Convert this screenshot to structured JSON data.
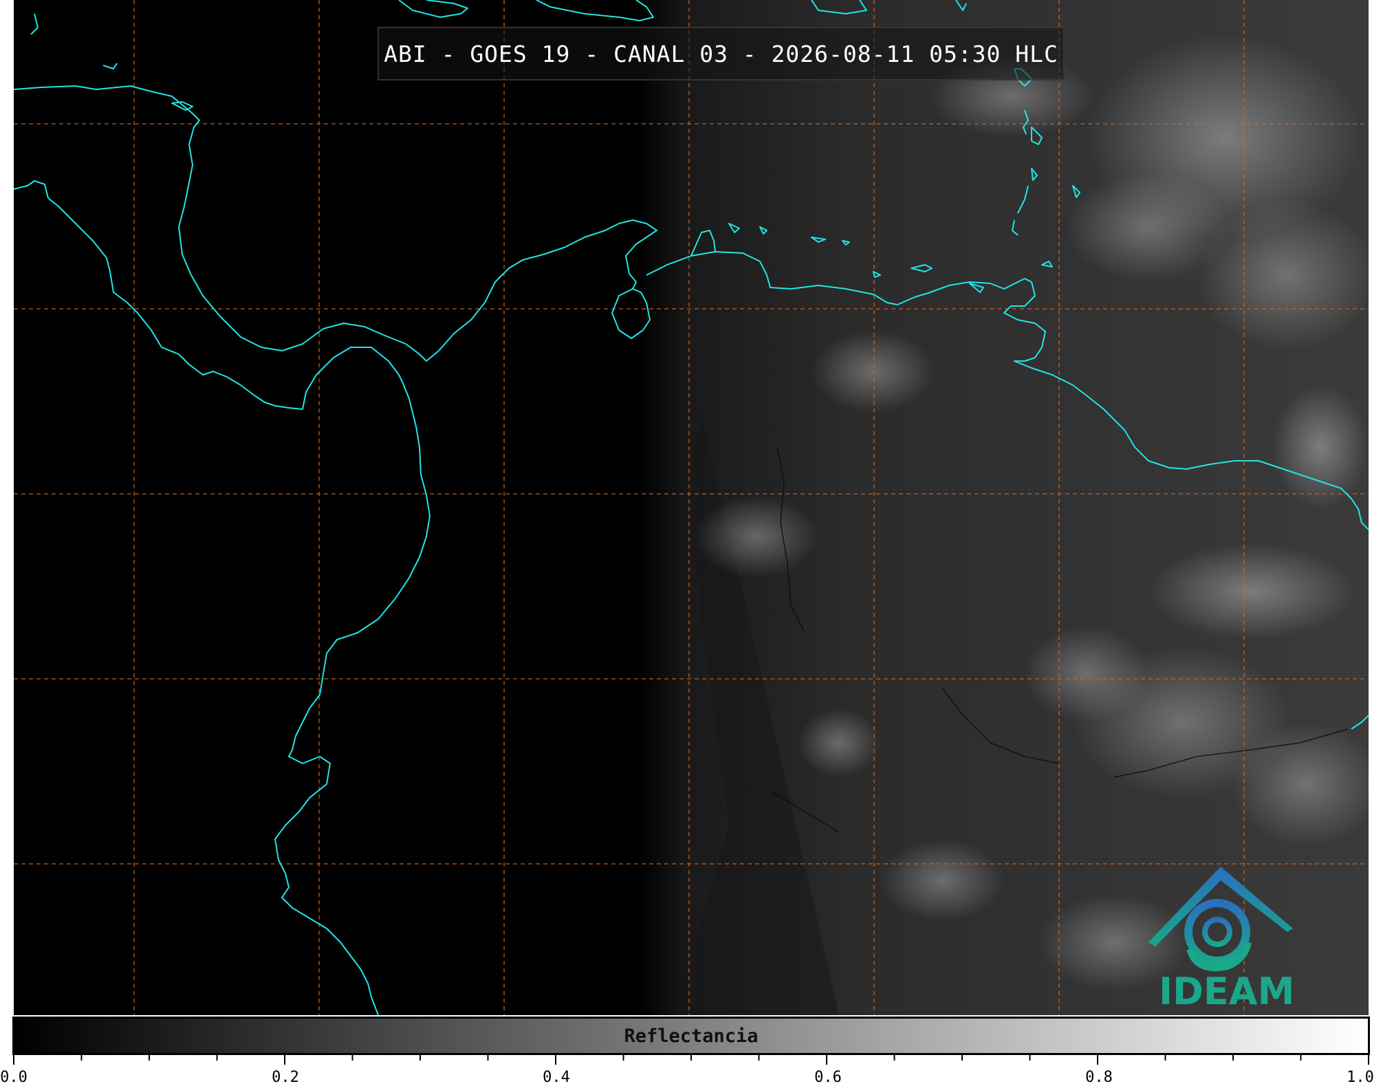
{
  "title": "ABI - GOES 19 - CANAL 03 - 2026-08-11 05:30 HLC",
  "logo_text": "IDEAM",
  "colorbar": {
    "label": "Reflectancia",
    "ticks": [
      "0.0",
      "0.2",
      "0.4",
      "0.6",
      "0.8",
      "1.0"
    ],
    "range": [
      0.0,
      1.0
    ],
    "colormap": "grayscale"
  },
  "colors": {
    "coastline": "#22e5e5",
    "gridline": "#d2691e",
    "background": "#000000",
    "logo_top": "#2a6fbf",
    "logo_bottom": "#1aa78a"
  }
}
